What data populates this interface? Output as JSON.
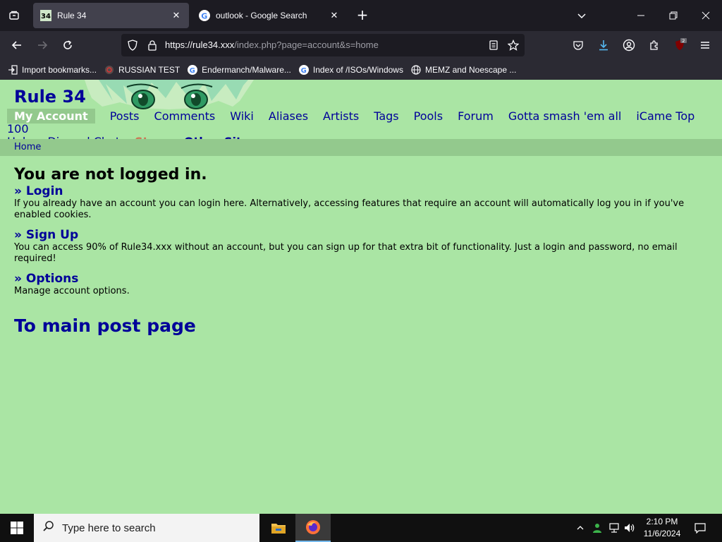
{
  "browser": {
    "tabs": [
      {
        "title": "Rule 34",
        "active": true
      },
      {
        "title": "outlook - Google Search",
        "active": false
      }
    ],
    "url": {
      "host": "https://rule34.xxx",
      "path": "/index.php?page=account&s=home"
    },
    "bookmarks": [
      {
        "label": "Import bookmarks...",
        "icon": "import-icon"
      },
      {
        "label": "RUSSIAN TEST",
        "icon": "site-icon"
      },
      {
        "label": "Endermanch/Malware...",
        "icon": "google-icon"
      },
      {
        "label": "Index of /ISOs/Windows",
        "icon": "google-icon"
      },
      {
        "label": "MEMZ and Noescape ...",
        "icon": "globe-icon"
      }
    ],
    "extension_badge": "2"
  },
  "site": {
    "title": "Rule 34",
    "nav": {
      "my_account": "My Account",
      "posts": "Posts",
      "comments": "Comments",
      "wiki": "Wiki",
      "aliases": "Aliases",
      "artists": "Artists",
      "tags": "Tags",
      "pools": "Pools",
      "forum": "Forum",
      "smash": "Gotta smash 'em all",
      "icame": "iCame Top 100",
      "help": "Help",
      "discord": "Discord Chat",
      "store": "Store",
      "other_sites": "Other Sites"
    },
    "breadcrumb": "Home"
  },
  "content": {
    "heading": "You are not logged in.",
    "sections": [
      {
        "link": "» Login",
        "text": "If you already have an account you can login here. Alternatively, accessing features that require an account will automatically log you in if you've enabled cookies."
      },
      {
        "link": "» Sign Up",
        "text": "You can access 90% of Rule34.xxx without an account, but you can sign up for that extra bit of functionality. Just a login and password, no email required!"
      },
      {
        "link": "» Options",
        "text": "Manage account options."
      }
    ],
    "main_link": "To main post page"
  },
  "taskbar": {
    "search_placeholder": "Type here to search",
    "time": "2:10 PM",
    "date": "11/6/2024"
  },
  "colors": {
    "page_bg": "#aae5a4",
    "link": "#000099",
    "store": "#cc7755",
    "nav_highlight": "#93c98d"
  }
}
